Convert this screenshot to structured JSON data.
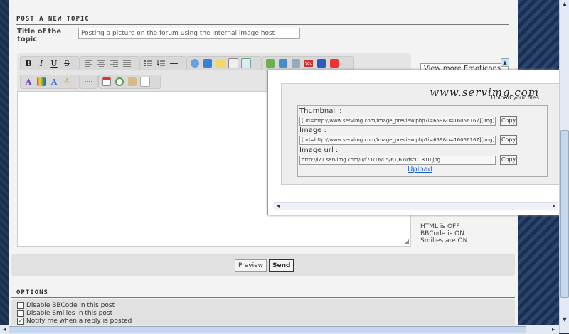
{
  "post_topic": {
    "heading": "POST A NEW TOPIC",
    "title_label": "Title of the topic",
    "title_value": "Posting a picture on the forum using the internal image host"
  },
  "toolbar": {
    "row1": [
      "bold-icon",
      "italic-icon",
      "underline-icon",
      "strikethrough-icon",
      "align-left-icon",
      "align-center-icon",
      "align-right-icon",
      "justify-icon",
      "bullet-list-icon",
      "numbered-list-icon",
      "horizontal-rule-icon",
      "quote-icon",
      "code-icon",
      "spoiler-icon",
      "hide-icon",
      "table-icon",
      "image-host-icon",
      "insert-image-icon",
      "link-icon",
      "youtube-icon",
      "flash-icon",
      "dailymotion-icon"
    ],
    "row2": [
      "font-icon",
      "color-icon",
      "font-size-icon",
      "font-style-icon",
      "line-break-icon",
      "date-icon",
      "search-icon",
      "paste-icon",
      "preview-icon"
    ],
    "text_glyphs": {
      "bold": "B",
      "italic": "I",
      "underline": "U",
      "strike": "S",
      "youtube": "You"
    }
  },
  "sidebar": {
    "emoticons_label": "View more Emoticons",
    "status": [
      "HTML is OFF",
      "BBCode is ON",
      "Smilies are ON"
    ]
  },
  "buttons": {
    "preview": "Preview",
    "send": "Send"
  },
  "options": {
    "heading": "OPTIONS",
    "items": [
      {
        "label": "Disable BBCode in this post",
        "checked": false
      },
      {
        "label": "Disable Smilies in this post",
        "checked": false
      },
      {
        "label": "Notify me when a reply is posted",
        "checked": true
      }
    ]
  },
  "popup": {
    "logo": "www.servimg.com",
    "tagline": "Upload your files",
    "fields": [
      {
        "label": "Thumbnail :",
        "value": "[url=http://www.servimg.com/image_preview.php?i=659&u=16056167][img]"
      },
      {
        "label": "Image :",
        "value": "[url=http://www.servimg.com/image_preview.php?i=659&u=16056167][img]"
      },
      {
        "label": "Image url :",
        "value": "http://i71.servimg.com/u/f71/16/05/61/67/dsc01810.jpg"
      }
    ],
    "copy_label": "Copy",
    "upload_label": "Upload"
  }
}
